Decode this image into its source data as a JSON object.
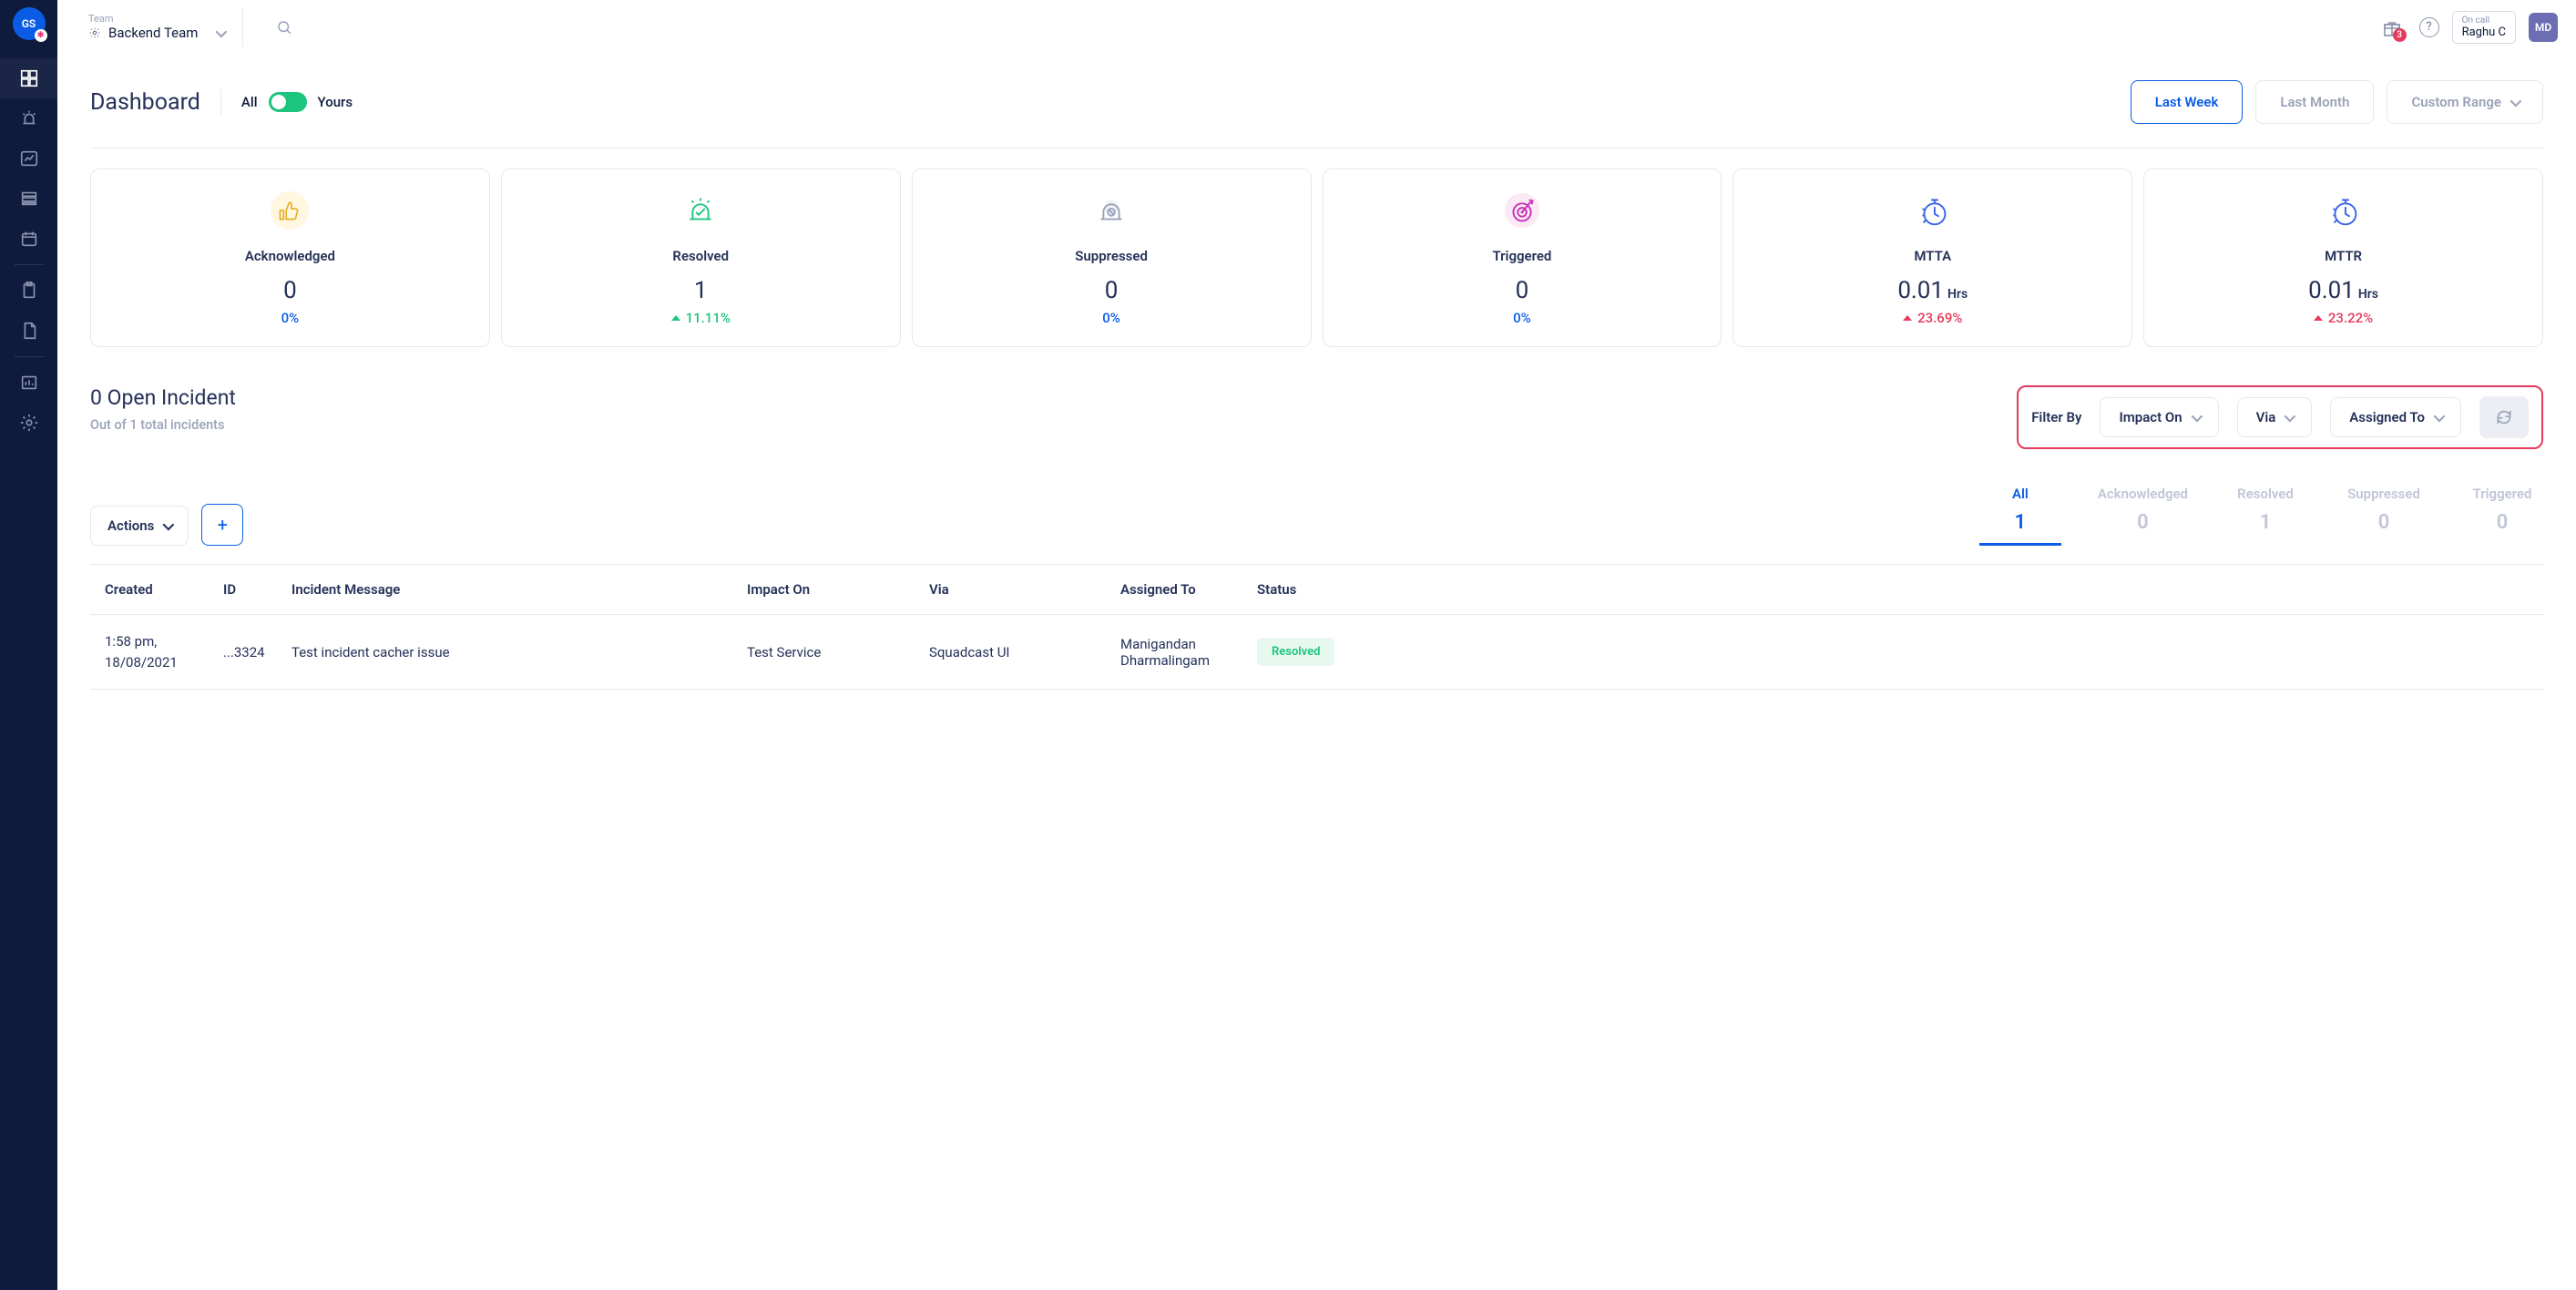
{
  "org": {
    "initials": "GS",
    "badge": "✱"
  },
  "team": {
    "label": "Team",
    "name": "Backend Team"
  },
  "header": {
    "gift_count": "3",
    "help_symbol": "?",
    "oncall_label": "On call",
    "oncall_name": "Raghu C",
    "user_initials": "MD"
  },
  "page": {
    "title": "Dashboard",
    "toggle_all": "All",
    "toggle_yours": "Yours",
    "range": {
      "last_week": "Last Week",
      "last_month": "Last Month",
      "custom": "Custom Range"
    }
  },
  "stats": {
    "acknowledged": {
      "label": "Acknowledged",
      "value": "0",
      "change": "0%"
    },
    "resolved": {
      "label": "Resolved",
      "value": "1",
      "change": "11.11%"
    },
    "suppressed": {
      "label": "Suppressed",
      "value": "0",
      "change": "0%"
    },
    "triggered": {
      "label": "Triggered",
      "value": "0",
      "change": "0%"
    },
    "mtta": {
      "label": "MTTA",
      "value": "0.01",
      "unit": "Hrs",
      "change": "23.69%"
    },
    "mttr": {
      "label": "MTTR",
      "value": "0.01",
      "unit": "Hrs",
      "change": "23.22%"
    }
  },
  "open": {
    "title": "0 Open Incident",
    "subtitle": "Out of 1 total incidents",
    "filter_label": "Filter By",
    "filters": {
      "impact": "Impact On",
      "via": "Via",
      "assigned": "Assigned To"
    }
  },
  "actions": {
    "label": "Actions",
    "plus": "+"
  },
  "tabs": {
    "all": {
      "label": "All",
      "count": "1"
    },
    "acknowledged": {
      "label": "Acknowledged",
      "count": "0"
    },
    "resolved": {
      "label": "Resolved",
      "count": "1"
    },
    "suppressed": {
      "label": "Suppressed",
      "count": "0"
    },
    "triggered": {
      "label": "Triggered",
      "count": "0"
    }
  },
  "table": {
    "headers": {
      "created": "Created",
      "id": "ID",
      "msg": "Incident Message",
      "impact": "Impact On",
      "via": "Via",
      "assigned": "Assigned To",
      "status": "Status"
    },
    "rows": [
      {
        "created_time": "1:58 pm,",
        "created_date": "18/08/2021",
        "id": "...3324",
        "msg": "Test incident cacher issue",
        "impact": "Test Service",
        "via": "Squadcast UI",
        "assigned1": "Manigandan",
        "assigned2": "Dharmalingam",
        "status": "Resolved"
      }
    ]
  }
}
